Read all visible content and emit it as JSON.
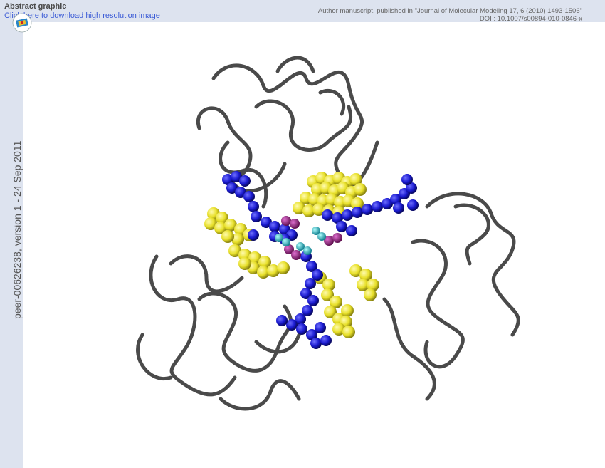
{
  "header": {
    "title": "Abstract graphic",
    "download_link": "Click here to download high resolution image",
    "manuscript_line": "Author manuscript, published in \"Journal of Molecular Modeling 17, 6 (2010) 1493-1506\"",
    "doi_line": "DOI : 10.1007/s00894-010-0846-x"
  },
  "sidebar": {
    "identifier": "peer-00626238, version 1 - 24 Sep 2011"
  },
  "logo": {
    "icon": "hal-archive-logo-icon"
  },
  "figure": {
    "description_icon": "protein-structure-image",
    "colors": {
      "ribbon": "#4a4a4a",
      "yellow_spheres": "#e8e02a",
      "blue_spheres": "#1a1ad0",
      "magenta_spheres": "#a0208c",
      "cyan_spheres": "#22c8d8",
      "topbar_bg": "#dde3ef",
      "link": "#3b5bd6"
    }
  }
}
